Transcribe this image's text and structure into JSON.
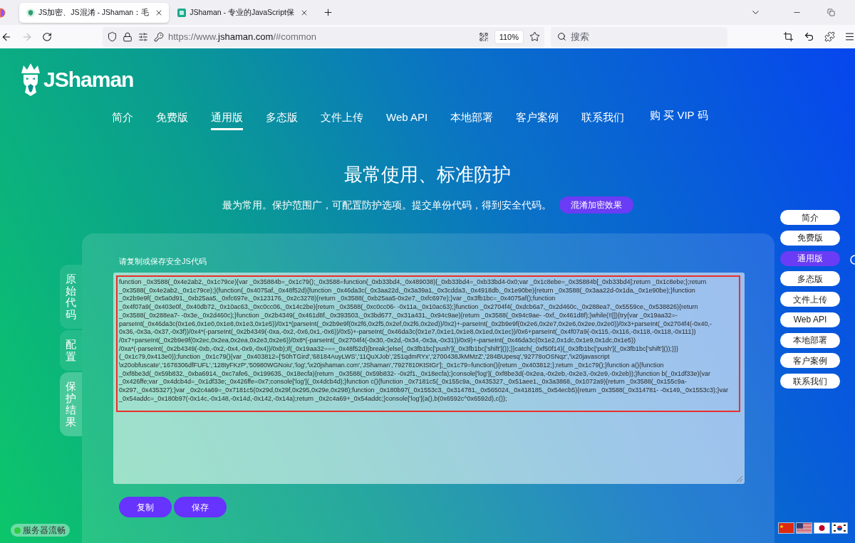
{
  "browser": {
    "tabs": [
      {
        "title": "JS加密、JS混淆 - JShaman：毛",
        "selected": true
      },
      {
        "title": "JShaman - 专业的JavaScript保",
        "selected": false
      }
    ],
    "url": [
      "https://www.",
      "jshaman.com",
      "/#common"
    ],
    "zoom": "110%",
    "search": {
      "placeholder": "搜索"
    }
  },
  "site": {
    "logo": "JShaman",
    "nav": [
      {
        "label": "简介",
        "selected": false
      },
      {
        "label": "免费版",
        "selected": false
      },
      {
        "label": "通用版",
        "selected": true
      },
      {
        "label": "多态版",
        "selected": false
      },
      {
        "label": "文件上传",
        "selected": false
      },
      {
        "label": "Web API",
        "selected": false
      },
      {
        "label": "本地部署",
        "selected": false
      },
      {
        "label": "客户案例",
        "selected": false
      },
      {
        "label": "联系我们",
        "selected": false
      }
    ],
    "vip": "购 买 VIP 码"
  },
  "hero": {
    "title": "最常使用、标准防护",
    "subtitle": "最为常用。保护范围广，可配置防护选项。提交单份代码，得到安全代码。",
    "button": "混淆加密效果"
  },
  "side_tabs": [
    {
      "label": "原始代码",
      "selected": false
    },
    {
      "label": "配置",
      "selected": false
    },
    {
      "label": "保护结果",
      "selected": true
    }
  ],
  "result": {
    "label": "请复制或保存安全JS代码",
    "code_lines": [
      "function _0x3588(_0x4e2ab2,_0x1c79ce){var _0x35884b=_0x1c79();_0x3588=function(_0xb33bd4,_0x489038){_0xb33bd4=_0xb33bd4-0x0;var _0x1c8ebe=_0x35884b[_0xb33bd4];return _0x1c8ebe;};return",
      "_0x3588(_0x4e2ab2,_0x1c79ce);}(function(_0x4075af,_0x48f52d){function _0x46da3c(_0x3aa22d,_0x3a39a1,_0x3cdda3,_0x4918db,_0x1e90be){return _0x3588(_0x3aa22d-0x1da,_0x1e90be);}function",
      "_0x2b9e9f(_0x5a0d91,_0xb25aa5,_0xfc697e,_0x123176,_0x2c3278){return _0x3588(_0xb25aa5-0x2e7,_0xfc697e);}var _0x3fb1bc=_0x4075af();function",
      "_0x4f07a9(_0x403e0f,_0x40db72,_0x10ac63,_0xc0cc06,_0x14c2be){return _0x3588(_0xc0cc06- -0x11a,_0x10ac63);}function _0x2704f4(_0xdcb6a7,_0x2d460c,_0x288ea7,_0x5559ce,_0x538826){return",
      "_0x3588(_0x288ea7- -0x3e,_0x2d460c);}function _0x2b4349(_0x461d8f,_0x393503,_0x3bd677,_0x31a431,_0x94c9ae){return _0x3588(_0x94c9ae- -0xf,_0x461d8f);}while(!![]){try{var _0x19aa32=-",
      "parseInt(_0x46da3c(0x1e6,0x1e0,0x1e8,0x1e3,0x1e5))/0x1*(parseInt(_0x2b9e9f(0x2f6,0x2f5,0x2ef,0x2f6,0x2ed))/0x2)+-parseInt(_0x2b9e9f(0x2e6,0x2e7,0x2e6,0x2ee,0x2e0))/0x3+parseInt(_0x2704f4(-0x40,-",
      "0x36,-0x3a,-0x37,-0x3f))/0x4*(-parseInt(_0x2b4349(-0xa,-0x2,-0x6,0x1,-0x6))/0x5)+-parseInt(_0x46da3c(0x1e7,0x1e1,0x1e8,0x1ed,0x1ec))/0x6+parseInt(_0x4f07a9(-0x115,-0x116,-0x118,-0x118,-0x111))",
      "/0x7+parseInt(_0x2b9e9f(0x2ec,0x2ea,0x2ea,0x2e3,0x2e6))/0x8*(-parseInt(_0x2704f4(-0x30,-0x2d,-0x34,-0x3a,-0x31))/0x9)+-parseInt(_0x46da3c(0x1e2,0x1dc,0x1e9,0x1dc,0x1e5))",
      "/0xa*(-parseInt(_0x2b4349(-0xb,-0x2,-0x4,-0x9,-0x4))/0xb);if(_0x19aa32===_0x48f52d){break;}else{_0x3fb1bc['push'](_0x3fb1bc['shift']());}}catch(_0xf50f14){_0x3fb1bc['push'](_0x3fb1bc['shift']());}}}",
      "(_0x1c79,0x413e0));function _0x1c79(){var _0x403812=['50hTGird','68184AuyLWS','11QuXJob','251qdmRYx','2700438JkMMzZ','284BUpesq','92778oOSNqz','\\x20javascript",
      "\\x20obfuscate','1678306dfFUFL','128tyFKzP','50980WGNoiu','log','\\x20jshaman.com','JShaman','7927810KtStGr'];_0x1c79=function(){return _0x403812;};return _0x1c79();}function a(){function",
      "_0xf8be3d(_0x59b832,_0xba6914,_0xc7afe6,_0x199635,_0x18ecfa){return _0x3588(_0x59b832- -0x2f1,_0x18ecfa);}console['log'](_0xf8be3d(-0x2ea,-0x2eb,-0x2e3,-0x2e9,-0x2eb));}function b(_0x1df33e){var",
      "_0x426ffe;var _0x4dcb4d=_0x1df33e;_0x426ffe=0x7;console['log'](_0x4dcb4d);}function c(){function _0x7181c5(_0x155c9a,_0x435327,_0x51aee1,_0x3a3868,_0x1072a9){return _0x3588(_0x155c9a-",
      "0x297,_0x435327);}var _0x2c4a69=_0x7181c5(0x29d,0x29f,0x295,0x29e,0x298);function _0x180b97(_0x1553c3,_0x314781,_0x565024,_0x418185,_0x54ecb5){return _0x3588(_0x314781- -0x149,_0x1553c3);}var",
      "_0x54addc=_0x180b97(-0x14c,-0x148,-0x14d,-0x142,-0x14a);return _0x2c4a69+_0x54addc;}console['log'](a(),b(0x6592c^0x6592d),c());"
    ],
    "buttons": [
      "复制",
      "保存"
    ]
  },
  "quick_nav": [
    {
      "label": "简介",
      "selected": false
    },
    {
      "label": "免费版",
      "selected": false
    },
    {
      "label": "通用版",
      "selected": true
    },
    {
      "label": "多态版",
      "selected": false
    },
    {
      "label": "文件上传",
      "selected": false
    },
    {
      "label": "Web API",
      "selected": false
    },
    {
      "label": "本地部署",
      "selected": false
    },
    {
      "label": "客户案例",
      "selected": false
    },
    {
      "label": "联系我们",
      "selected": false
    }
  ],
  "status": "服务器流畅"
}
